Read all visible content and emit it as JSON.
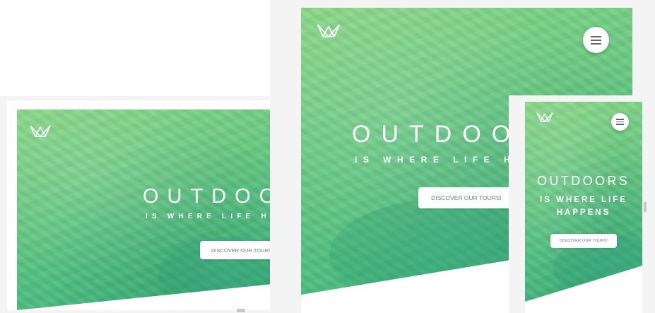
{
  "brand": {
    "logo_icon": "crown-icon"
  },
  "menu": {
    "icon": "hamburger-menu-icon"
  },
  "hero": {
    "title": "OUTDOORS",
    "subtitle": "IS WHERE LIFE HAPPENS",
    "cta_label": "DISCOVER OUR TOURS!"
  },
  "colors": {
    "gradient_start": "#8ad888",
    "gradient_end": "#3aae7a",
    "button_text": "#777777",
    "frame": "#f4f4f4"
  }
}
